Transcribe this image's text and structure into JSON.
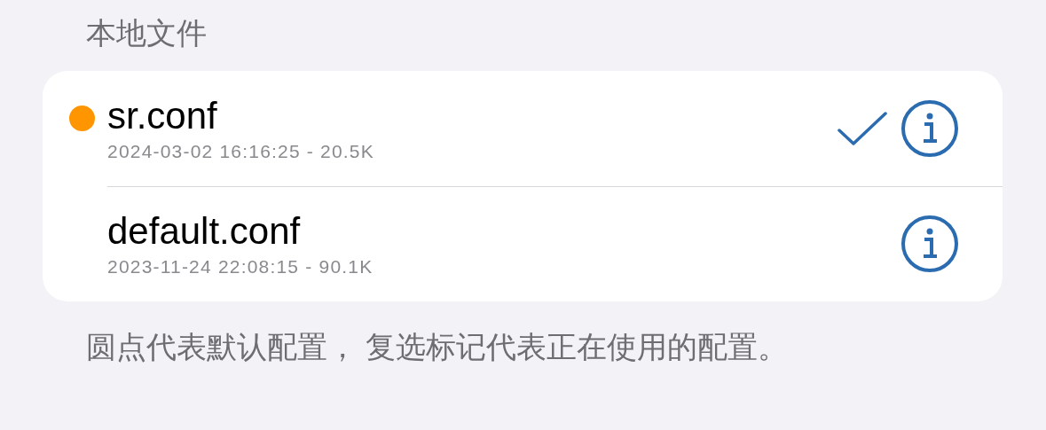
{
  "section_title": "本地文件",
  "files": [
    {
      "name": "sr.conf",
      "meta": "2024-03-02 16:16:25 - 20.5K",
      "default": true,
      "selected": true
    },
    {
      "name": "default.conf",
      "meta": "2023-11-24 22:08:15 - 90.1K",
      "default": false,
      "selected": false
    }
  ],
  "footer": "圆点代表默认配置， 复选标记代表正在使用的配置。"
}
